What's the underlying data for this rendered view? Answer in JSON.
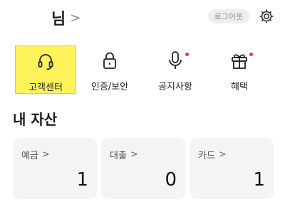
{
  "header": {
    "user_name": "님",
    "chevron": ">",
    "logout_label": "로그아웃"
  },
  "quick_menu": [
    {
      "label": "고객센터",
      "icon": "headset-icon",
      "active": true,
      "badge": false
    },
    {
      "label": "인증/보안",
      "icon": "lock-icon",
      "active": false,
      "badge": false
    },
    {
      "label": "공지사항",
      "icon": "microphone-icon",
      "active": false,
      "badge": true
    },
    {
      "label": "혜택",
      "icon": "gift-icon",
      "active": false,
      "badge": true
    }
  ],
  "assets": {
    "title": "내 자산",
    "cards": [
      {
        "name": "예금",
        "chevron": ">",
        "value": "1"
      },
      {
        "name": "대출",
        "chevron": ">",
        "value": "0"
      },
      {
        "name": "카드",
        "chevron": ">",
        "value": "1"
      }
    ]
  },
  "colors": {
    "highlight": "#fff35a",
    "badge": "#e53935",
    "card_bg": "#f4f4f6"
  }
}
